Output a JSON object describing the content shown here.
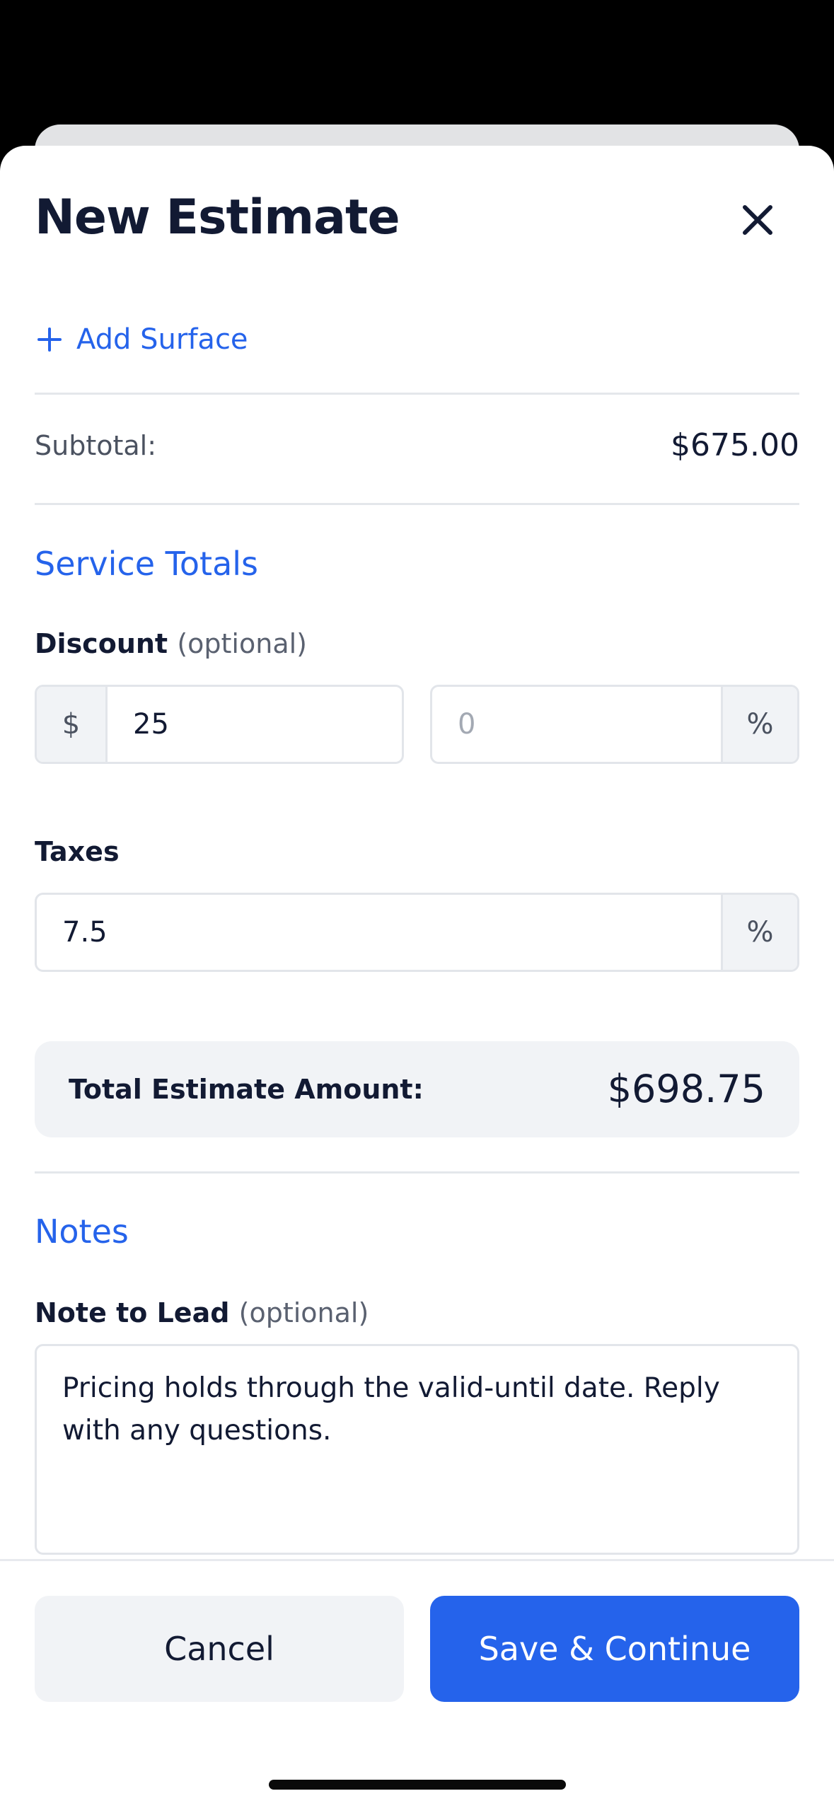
{
  "header": {
    "title": "New Estimate",
    "close_icon": "close-icon"
  },
  "surfaces": {
    "add_label": "Add Surface",
    "add_icon": "plus-icon"
  },
  "subtotal": {
    "label": "Subtotal:",
    "value": "$675.00"
  },
  "service_totals": {
    "heading": "Service Totals",
    "discount": {
      "label": "Discount",
      "optional": "(optional)",
      "currency_symbol": "$",
      "amount_value": "25",
      "percent_placeholder": "0",
      "percent_symbol": "%"
    },
    "taxes": {
      "label": "Taxes",
      "value": "7.5",
      "percent_symbol": "%"
    },
    "total": {
      "label": "Total Estimate Amount:",
      "value": "$698.75"
    }
  },
  "notes": {
    "heading": "Notes",
    "note_label": "Note to Lead",
    "optional": "(optional)",
    "note_value": "Pricing holds through the valid-until date. Reply with any questions."
  },
  "footer": {
    "cancel_label": "Cancel",
    "save_label": "Save & Continue"
  },
  "colors": {
    "accent": "#2563eb",
    "text": "#121a33",
    "muted": "#4b5260",
    "surface": "#f1f3f6"
  }
}
